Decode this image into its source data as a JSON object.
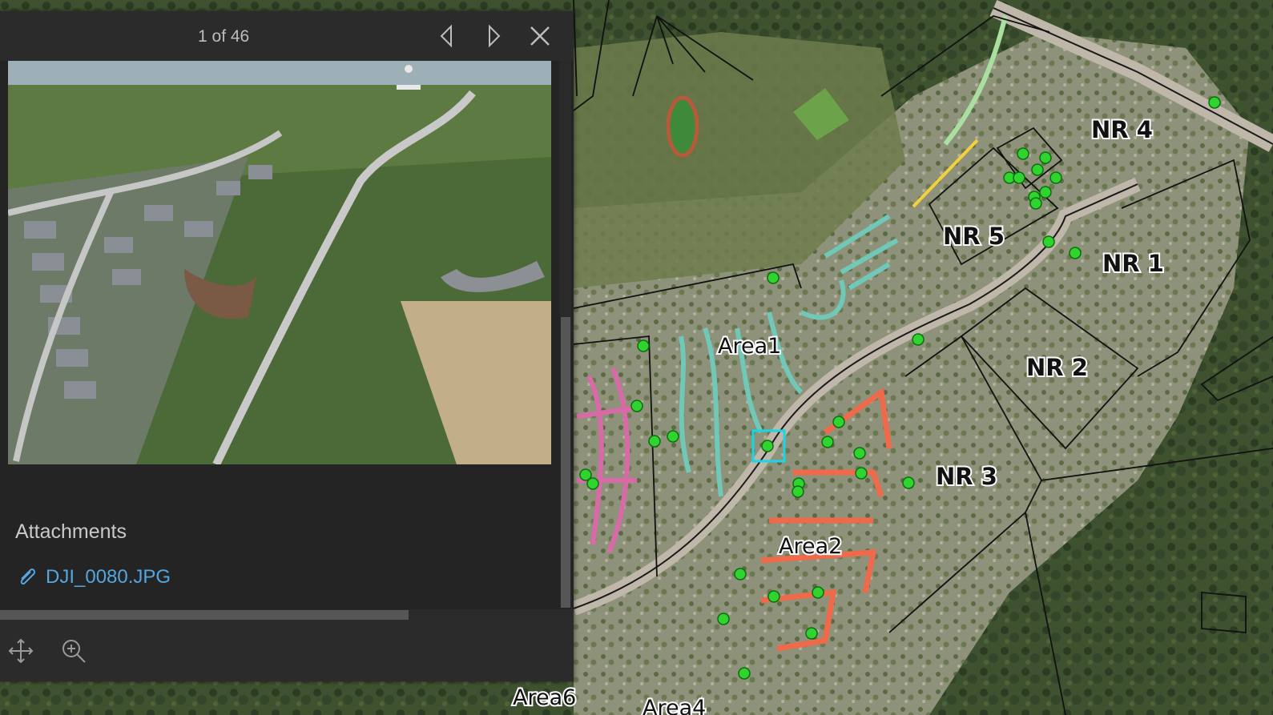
{
  "popup": {
    "counter": "1 of 46",
    "attachments_title": "Attachments",
    "attachment_file": "DJI_0080.JPG",
    "colors": {
      "background": "#242424",
      "header": "#2b2b2b",
      "link": "#53a6e0",
      "text": "#c9c9c9"
    },
    "icons": {
      "previous": "chevron-left-icon",
      "next": "chevron-right-icon",
      "close": "close-icon",
      "attachment": "paperclip-icon",
      "pan": "pan-arrows-icon",
      "zoom": "zoom-in-icon"
    }
  },
  "map": {
    "labels": {
      "nr4": "NR 4",
      "nr5": "NR 5",
      "nr1": "NR 1",
      "nr2": "NR 2",
      "nr3": "NR 3",
      "area1": "Area1",
      "area2": "Area2",
      "area6": "Area6",
      "area4": "Area4"
    },
    "colors": {
      "points": "#2fd42f",
      "selection": "#18d6e6",
      "parcel_lines": "#111111",
      "area1_lots": "#6fc8b8",
      "area2_lots": "#ef6a4a",
      "west_lots": "#d86aa8"
    }
  }
}
